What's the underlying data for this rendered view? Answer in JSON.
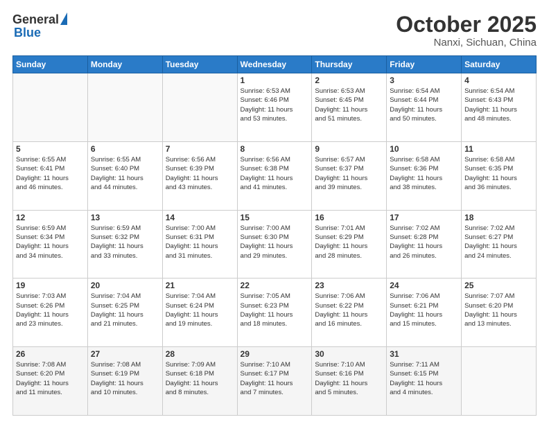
{
  "logo": {
    "general": "General",
    "blue": "Blue"
  },
  "title": {
    "main": "October 2025",
    "sub": "Nanxi, Sichuan, China"
  },
  "header_days": [
    "Sunday",
    "Monday",
    "Tuesday",
    "Wednesday",
    "Thursday",
    "Friday",
    "Saturday"
  ],
  "weeks": [
    [
      {
        "num": "",
        "info": ""
      },
      {
        "num": "",
        "info": ""
      },
      {
        "num": "",
        "info": ""
      },
      {
        "num": "1",
        "info": "Sunrise: 6:53 AM\nSunset: 6:46 PM\nDaylight: 11 hours\nand 53 minutes."
      },
      {
        "num": "2",
        "info": "Sunrise: 6:53 AM\nSunset: 6:45 PM\nDaylight: 11 hours\nand 51 minutes."
      },
      {
        "num": "3",
        "info": "Sunrise: 6:54 AM\nSunset: 6:44 PM\nDaylight: 11 hours\nand 50 minutes."
      },
      {
        "num": "4",
        "info": "Sunrise: 6:54 AM\nSunset: 6:43 PM\nDaylight: 11 hours\nand 48 minutes."
      }
    ],
    [
      {
        "num": "5",
        "info": "Sunrise: 6:55 AM\nSunset: 6:41 PM\nDaylight: 11 hours\nand 46 minutes."
      },
      {
        "num": "6",
        "info": "Sunrise: 6:55 AM\nSunset: 6:40 PM\nDaylight: 11 hours\nand 44 minutes."
      },
      {
        "num": "7",
        "info": "Sunrise: 6:56 AM\nSunset: 6:39 PM\nDaylight: 11 hours\nand 43 minutes."
      },
      {
        "num": "8",
        "info": "Sunrise: 6:56 AM\nSunset: 6:38 PM\nDaylight: 11 hours\nand 41 minutes."
      },
      {
        "num": "9",
        "info": "Sunrise: 6:57 AM\nSunset: 6:37 PM\nDaylight: 11 hours\nand 39 minutes."
      },
      {
        "num": "10",
        "info": "Sunrise: 6:58 AM\nSunset: 6:36 PM\nDaylight: 11 hours\nand 38 minutes."
      },
      {
        "num": "11",
        "info": "Sunrise: 6:58 AM\nSunset: 6:35 PM\nDaylight: 11 hours\nand 36 minutes."
      }
    ],
    [
      {
        "num": "12",
        "info": "Sunrise: 6:59 AM\nSunset: 6:34 PM\nDaylight: 11 hours\nand 34 minutes."
      },
      {
        "num": "13",
        "info": "Sunrise: 6:59 AM\nSunset: 6:32 PM\nDaylight: 11 hours\nand 33 minutes."
      },
      {
        "num": "14",
        "info": "Sunrise: 7:00 AM\nSunset: 6:31 PM\nDaylight: 11 hours\nand 31 minutes."
      },
      {
        "num": "15",
        "info": "Sunrise: 7:00 AM\nSunset: 6:30 PM\nDaylight: 11 hours\nand 29 minutes."
      },
      {
        "num": "16",
        "info": "Sunrise: 7:01 AM\nSunset: 6:29 PM\nDaylight: 11 hours\nand 28 minutes."
      },
      {
        "num": "17",
        "info": "Sunrise: 7:02 AM\nSunset: 6:28 PM\nDaylight: 11 hours\nand 26 minutes."
      },
      {
        "num": "18",
        "info": "Sunrise: 7:02 AM\nSunset: 6:27 PM\nDaylight: 11 hours\nand 24 minutes."
      }
    ],
    [
      {
        "num": "19",
        "info": "Sunrise: 7:03 AM\nSunset: 6:26 PM\nDaylight: 11 hours\nand 23 minutes."
      },
      {
        "num": "20",
        "info": "Sunrise: 7:04 AM\nSunset: 6:25 PM\nDaylight: 11 hours\nand 21 minutes."
      },
      {
        "num": "21",
        "info": "Sunrise: 7:04 AM\nSunset: 6:24 PM\nDaylight: 11 hours\nand 19 minutes."
      },
      {
        "num": "22",
        "info": "Sunrise: 7:05 AM\nSunset: 6:23 PM\nDaylight: 11 hours\nand 18 minutes."
      },
      {
        "num": "23",
        "info": "Sunrise: 7:06 AM\nSunset: 6:22 PM\nDaylight: 11 hours\nand 16 minutes."
      },
      {
        "num": "24",
        "info": "Sunrise: 7:06 AM\nSunset: 6:21 PM\nDaylight: 11 hours\nand 15 minutes."
      },
      {
        "num": "25",
        "info": "Sunrise: 7:07 AM\nSunset: 6:20 PM\nDaylight: 11 hours\nand 13 minutes."
      }
    ],
    [
      {
        "num": "26",
        "info": "Sunrise: 7:08 AM\nSunset: 6:20 PM\nDaylight: 11 hours\nand 11 minutes."
      },
      {
        "num": "27",
        "info": "Sunrise: 7:08 AM\nSunset: 6:19 PM\nDaylight: 11 hours\nand 10 minutes."
      },
      {
        "num": "28",
        "info": "Sunrise: 7:09 AM\nSunset: 6:18 PM\nDaylight: 11 hours\nand 8 minutes."
      },
      {
        "num": "29",
        "info": "Sunrise: 7:10 AM\nSunset: 6:17 PM\nDaylight: 11 hours\nand 7 minutes."
      },
      {
        "num": "30",
        "info": "Sunrise: 7:10 AM\nSunset: 6:16 PM\nDaylight: 11 hours\nand 5 minutes."
      },
      {
        "num": "31",
        "info": "Sunrise: 7:11 AM\nSunset: 6:15 PM\nDaylight: 11 hours\nand 4 minutes."
      },
      {
        "num": "",
        "info": ""
      }
    ]
  ]
}
